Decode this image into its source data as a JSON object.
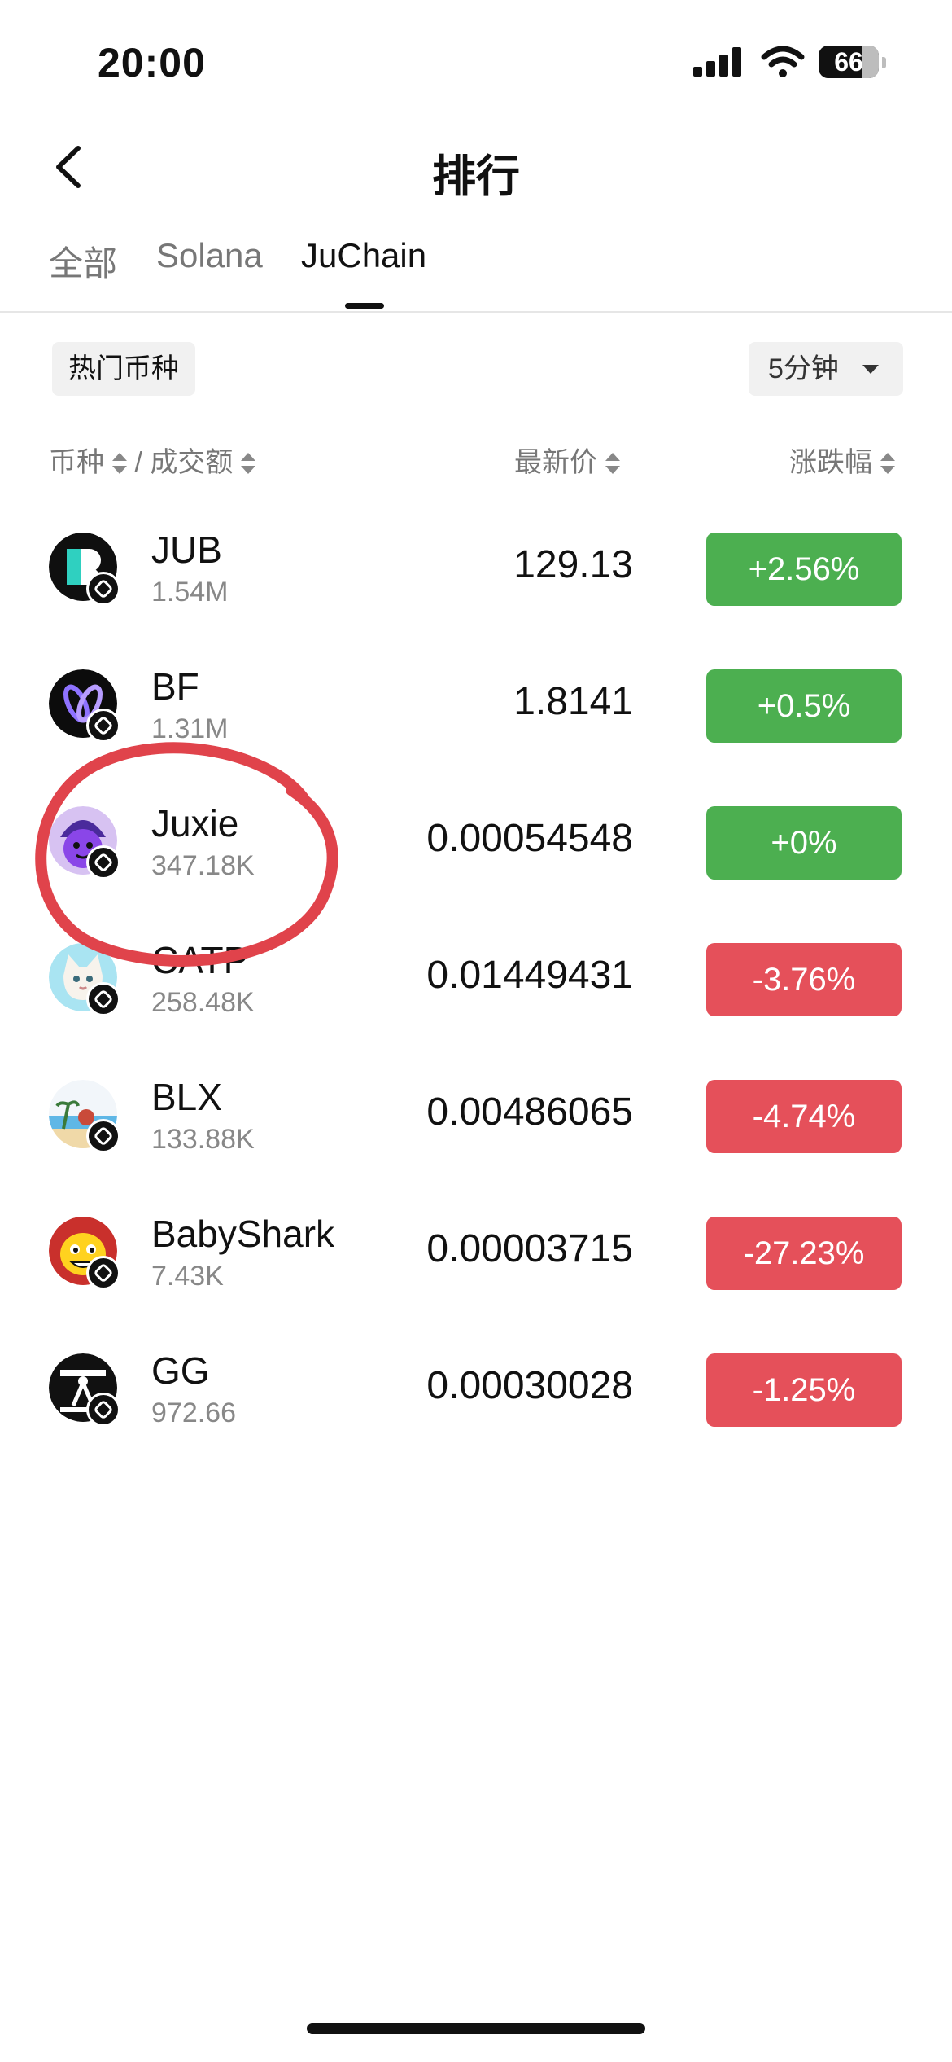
{
  "status_bar": {
    "time": "20:00",
    "battery": "66"
  },
  "header": {
    "title": "排行"
  },
  "tabs": [
    {
      "label": "全部",
      "active": false
    },
    {
      "label": "Solana",
      "active": false
    },
    {
      "label": "JuChain",
      "active": true
    }
  ],
  "filters": {
    "category": "热门币种",
    "period": "5分钟"
  },
  "columns": {
    "coin": "币种",
    "separator": "/",
    "volume": "成交额",
    "price": "最新价",
    "change": "涨跌幅"
  },
  "colors": {
    "up": "#4caf50",
    "down": "#e5505a",
    "annotation": "#e0434b"
  },
  "rows": [
    {
      "name": "JUB",
      "volume": "1.54M",
      "price": "129.13",
      "change": "+2.56%",
      "direction": "up",
      "icon": "jub-coin-icon"
    },
    {
      "name": "BF",
      "volume": "1.31M",
      "price": "1.8141",
      "change": "+0.5%",
      "direction": "up",
      "icon": "bf-coin-icon"
    },
    {
      "name": "Juxie",
      "volume": "347.18K",
      "price": "0.00054548",
      "change": "+0%",
      "direction": "up",
      "icon": "juxie-coin-icon"
    },
    {
      "name": "CATP",
      "volume": "258.48K",
      "price": "0.01449431",
      "change": "-3.76%",
      "direction": "down",
      "icon": "catp-coin-icon"
    },
    {
      "name": "BLX",
      "volume": "133.88K",
      "price": "0.00486065",
      "change": "-4.74%",
      "direction": "down",
      "icon": "blx-coin-icon"
    },
    {
      "name": "BabyShark",
      "volume": "7.43K",
      "price": "0.00003715",
      "change": "-27.23%",
      "direction": "down",
      "icon": "babyshark-coin-icon"
    },
    {
      "name": "GG",
      "volume": "972.66",
      "price": "0.00030028",
      "change": "-1.25%",
      "direction": "down",
      "icon": "gg-coin-icon"
    }
  ]
}
